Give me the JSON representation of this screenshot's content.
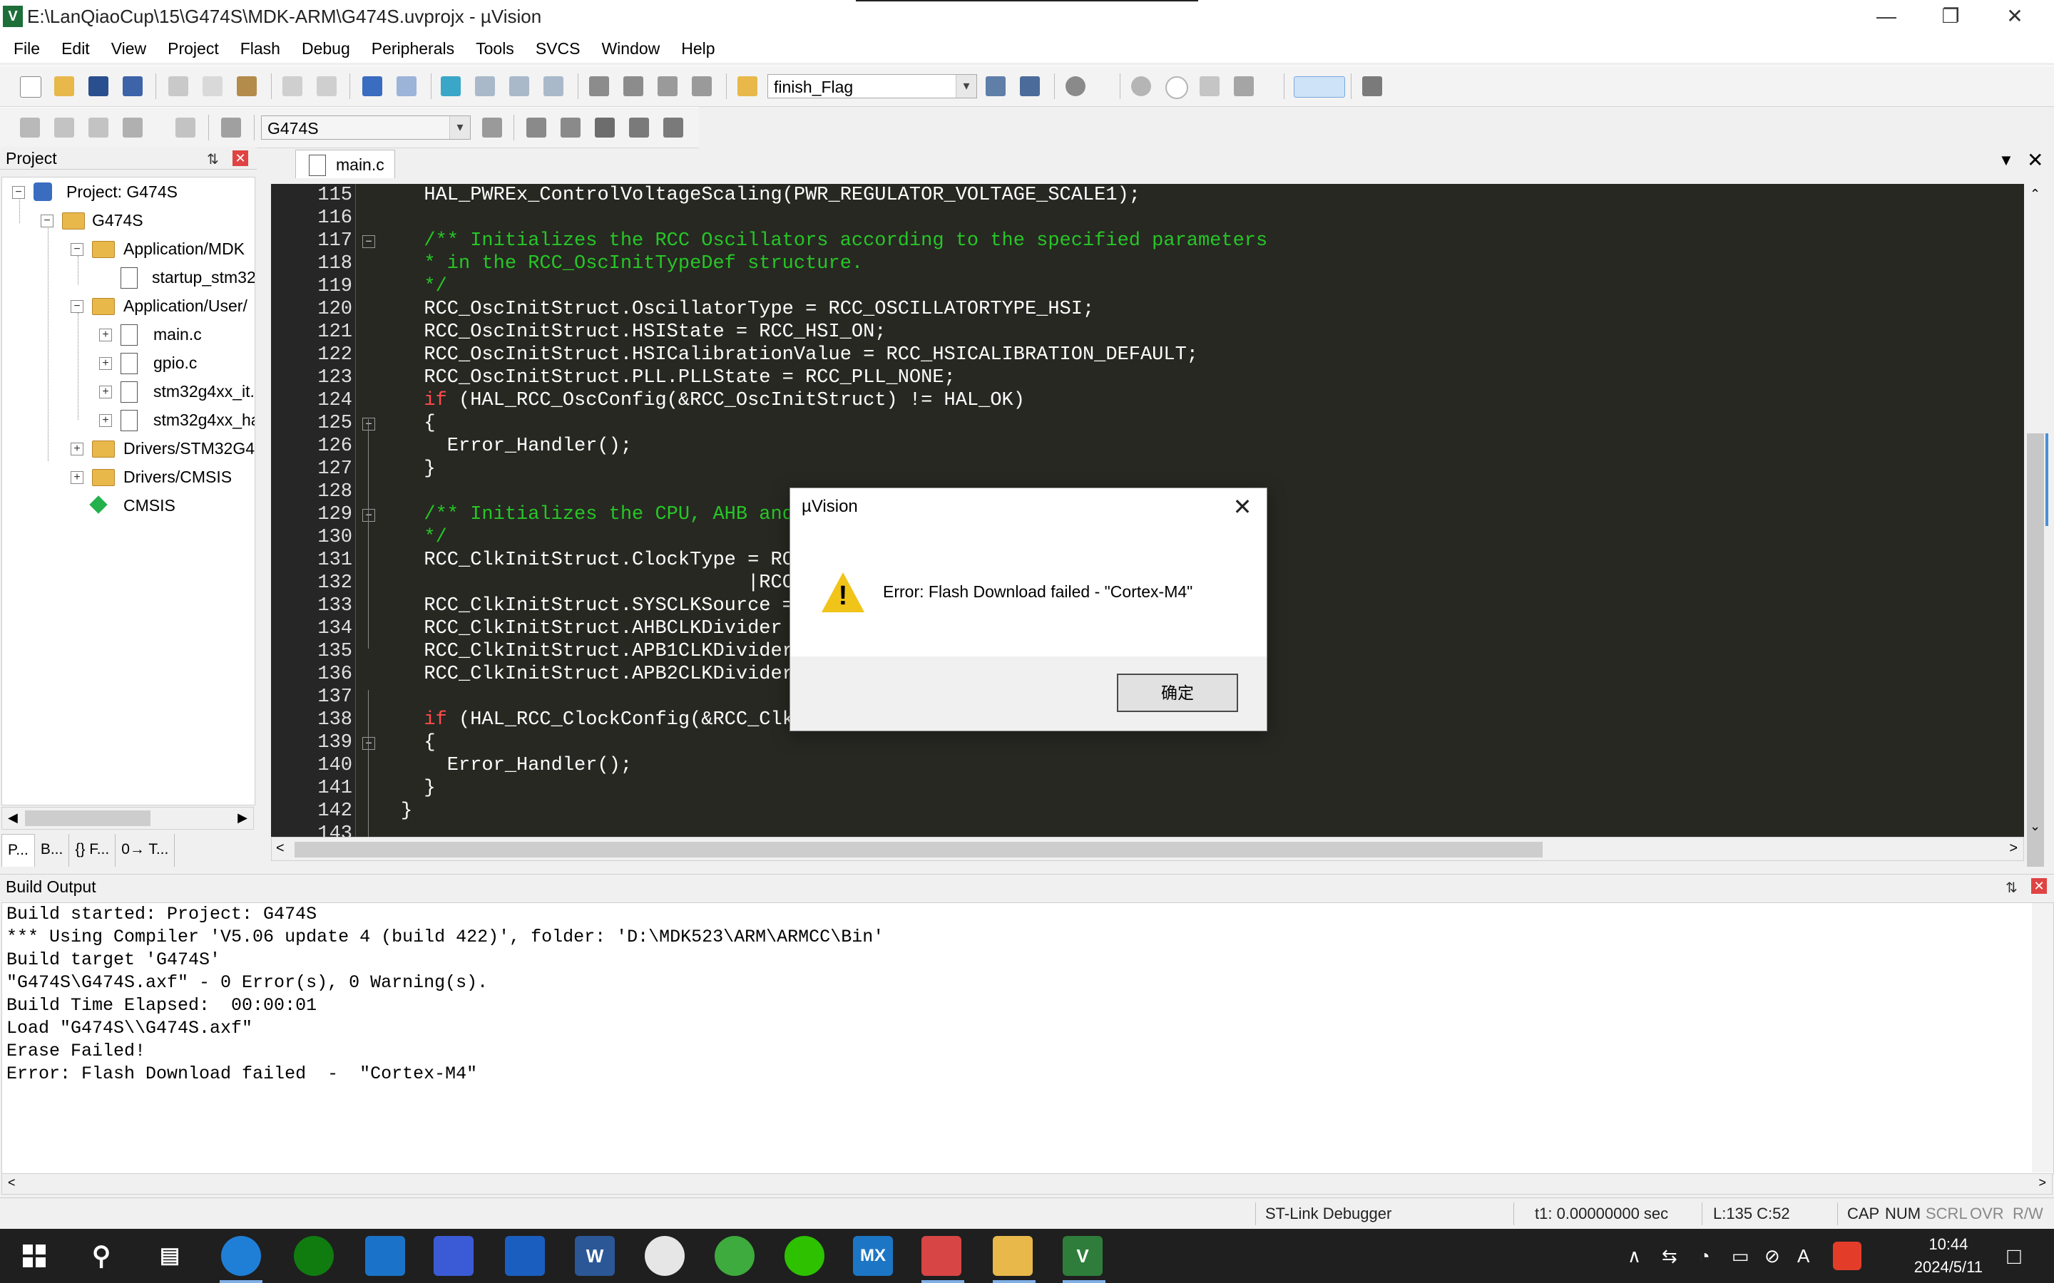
{
  "window": {
    "title": "E:\\LanQiaoCup\\15\\G474S\\MDK-ARM\\G474S.uvprojx - µVision",
    "app_icon_label": "V",
    "controls": {
      "minimize": "—",
      "restore": "❐",
      "close": "✕"
    }
  },
  "menu": [
    "File",
    "Edit",
    "View",
    "Project",
    "Flash",
    "Debug",
    "Peripherals",
    "Tools",
    "SVCS",
    "Window",
    "Help"
  ],
  "toolbar1": {
    "find_combo_value": "finish_Flag"
  },
  "toolbar2": {
    "target_combo_value": "G474S"
  },
  "project_panel": {
    "title": "Project",
    "tree": [
      {
        "label": "Project: G474S"
      },
      {
        "label": "G474S"
      },
      {
        "label": "Application/MDK"
      },
      {
        "label": "startup_stm32"
      },
      {
        "label": "Application/User/"
      },
      {
        "label": "main.c"
      },
      {
        "label": "gpio.c"
      },
      {
        "label": "stm32g4xx_it."
      },
      {
        "label": "stm32g4xx_ha"
      },
      {
        "label": "Drivers/STM32G4"
      },
      {
        "label": "Drivers/CMSIS"
      },
      {
        "label": "CMSIS"
      }
    ],
    "tabs": [
      "P...",
      "B...",
      "{} F...",
      "0→ T..."
    ]
  },
  "editor": {
    "active_tab": "main.c",
    "line_numbers": [
      "115",
      "116",
      "117",
      "118",
      "119",
      "120",
      "121",
      "122",
      "123",
      "124",
      "125",
      "126",
      "127",
      "128",
      "129",
      "130",
      "131",
      "132",
      "133",
      "134",
      "135",
      "136",
      "137",
      "138",
      "139",
      "140",
      "141",
      "142",
      "143"
    ],
    "lines": [
      "  HAL_PWREx_ControlVoltageScaling(PWR_REGULATOR_VOLTAGE_SCALE1);",
      "",
      "  /** Initializes the RCC Oscillators according to the specified parameters",
      "  * in the RCC_OscInitTypeDef structure.",
      "  */",
      "  RCC_OscInitStruct.OscillatorType = RCC_OSCILLATORTYPE_HSI;",
      "  RCC_OscInitStruct.HSIState = RCC_HSI_ON;",
      "  RCC_OscInitStruct.HSICalibrationValue = RCC_HSICALIBRATION_DEFAULT;",
      "  RCC_OscInitStruct.PLL.PLLState = RCC_PLL_NONE;",
      "  if (HAL_RCC_OscConfig(&RCC_OscInitStruct) != HAL_OK)",
      "  {",
      "    Error_Handler();",
      "  }",
      "",
      "  /** Initializes the CPU, AHB and A",
      "  */",
      "  RCC_ClkInitStruct.ClockType = RCC_",
      "                              |RCC_C",
      "  RCC_ClkInitStruct.SYSCLKSource = R",
      "  RCC_ClkInitStruct.AHBCLKDivider = ",
      "  RCC_ClkInitStruct.APB1CLKDivider = ",
      "  RCC_ClkInitStruct.APB2CLKDivider = ",
      "",
      "  if (HAL_RCC_ClockConfig(&RCC_ClkIn",
      "  {",
      "    Error_Handler();",
      "  }",
      "}",
      ""
    ]
  },
  "dialog": {
    "title": "µVision",
    "message": "Error: Flash Download failed  -  \"Cortex-M4\"",
    "ok_label": "确定",
    "close_label": "✕"
  },
  "build_output": {
    "title": "Build Output",
    "lines": [
      "Build started: Project: G474S",
      "*** Using Compiler 'V5.06 update 4 (build 422)', folder: 'D:\\MDK523\\ARM\\ARMCC\\Bin'",
      "Build target 'G474S'",
      "\"G474S\\G474S.axf\" - 0 Error(s), 0 Warning(s).",
      "Build Time Elapsed:  00:00:01",
      "Load \"G474S\\\\G474S.axf\"",
      "Erase Failed!",
      "Error: Flash Download failed  -  \"Cortex-M4\""
    ]
  },
  "status": {
    "debugger": "ST-Link Debugger",
    "time": "t1: 0.00000000 sec",
    "cursor": "L:135 C:52",
    "caps": "CAP",
    "num": "NUM",
    "scrl": "SCRL",
    "ovr": "OVR",
    "rw": "R/W"
  },
  "taskbar": {
    "apps": [
      "start",
      "search",
      "task-view",
      "edge",
      "xbox",
      "mail",
      "visual-studio",
      "calendar",
      "word",
      "clock",
      "browser",
      "wechat",
      "mx",
      "tool",
      "file-explorer",
      "keil"
    ],
    "word_icon_label": "W",
    "mx_label": "MX",
    "keil_label": "V",
    "tray": [
      "∧",
      "⇆",
      "◔",
      "▭",
      "⊘",
      "A"
    ],
    "time": "10:44",
    "date": "2024/5/11"
  }
}
